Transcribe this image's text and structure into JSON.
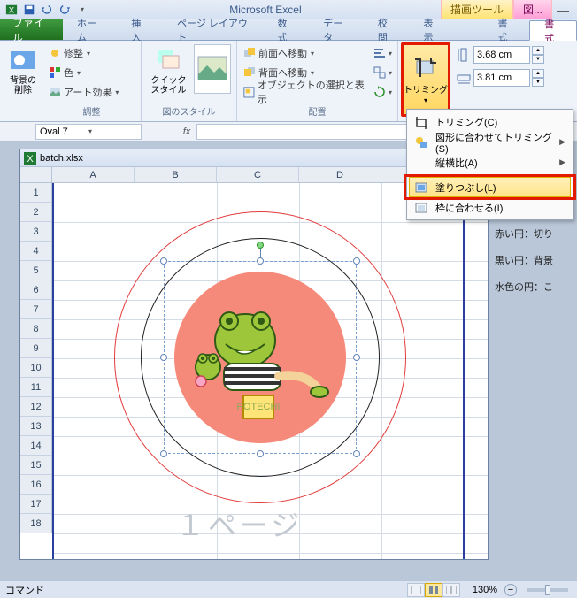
{
  "app": {
    "title": "Microsoft Excel"
  },
  "context_tabs": {
    "drawing": "描画ツール",
    "picture": "図..."
  },
  "tabs": {
    "file": "ファイル",
    "home": "ホーム",
    "insert": "挿入",
    "pagelayout": "ページ レイアウト",
    "formulas": "数式",
    "data": "データ",
    "review": "校閲",
    "view": "表示",
    "format_draw": "書式",
    "format_pic": "書式"
  },
  "ribbon": {
    "remove_bg": "背景の削除",
    "corrections": "修整",
    "color": "色",
    "artistic": "アート効果",
    "adjust_label": "調整",
    "quick_styles": "クイック スタイル",
    "styles_label": "図のスタイル",
    "bring_forward": "前面へ移動",
    "send_backward": "背面へ移動",
    "selection_pane": "オブジェクトの選択と表示",
    "arrange_label": "配置",
    "crop": "トリミング",
    "height": "3.68 cm",
    "width": "3.81 cm"
  },
  "crop_menu": {
    "crop": "トリミング(C)",
    "crop_to_shape": "図形に合わせてトリミング(S)",
    "aspect": "縦横比(A)",
    "fill": "塗りつぶし(L)",
    "fit": "枠に合わせる(I)"
  },
  "name_box": "Oval 7",
  "workbook": "batch.xlsx",
  "cols": [
    "A",
    "B",
    "C",
    "D"
  ],
  "rows": [
    "1",
    "2",
    "3",
    "4",
    "5",
    "6",
    "7",
    "8",
    "9",
    "10",
    "11",
    "12",
    "13",
    "14",
    "15",
    "16",
    "17",
    "18"
  ],
  "page_watermark": "１ページ",
  "notes": {
    "a": "赤い円：切り",
    "b": "黒い円：背景",
    "c": "水色の円：こ"
  },
  "status": {
    "mode": "コマンド",
    "zoom": "130%"
  }
}
